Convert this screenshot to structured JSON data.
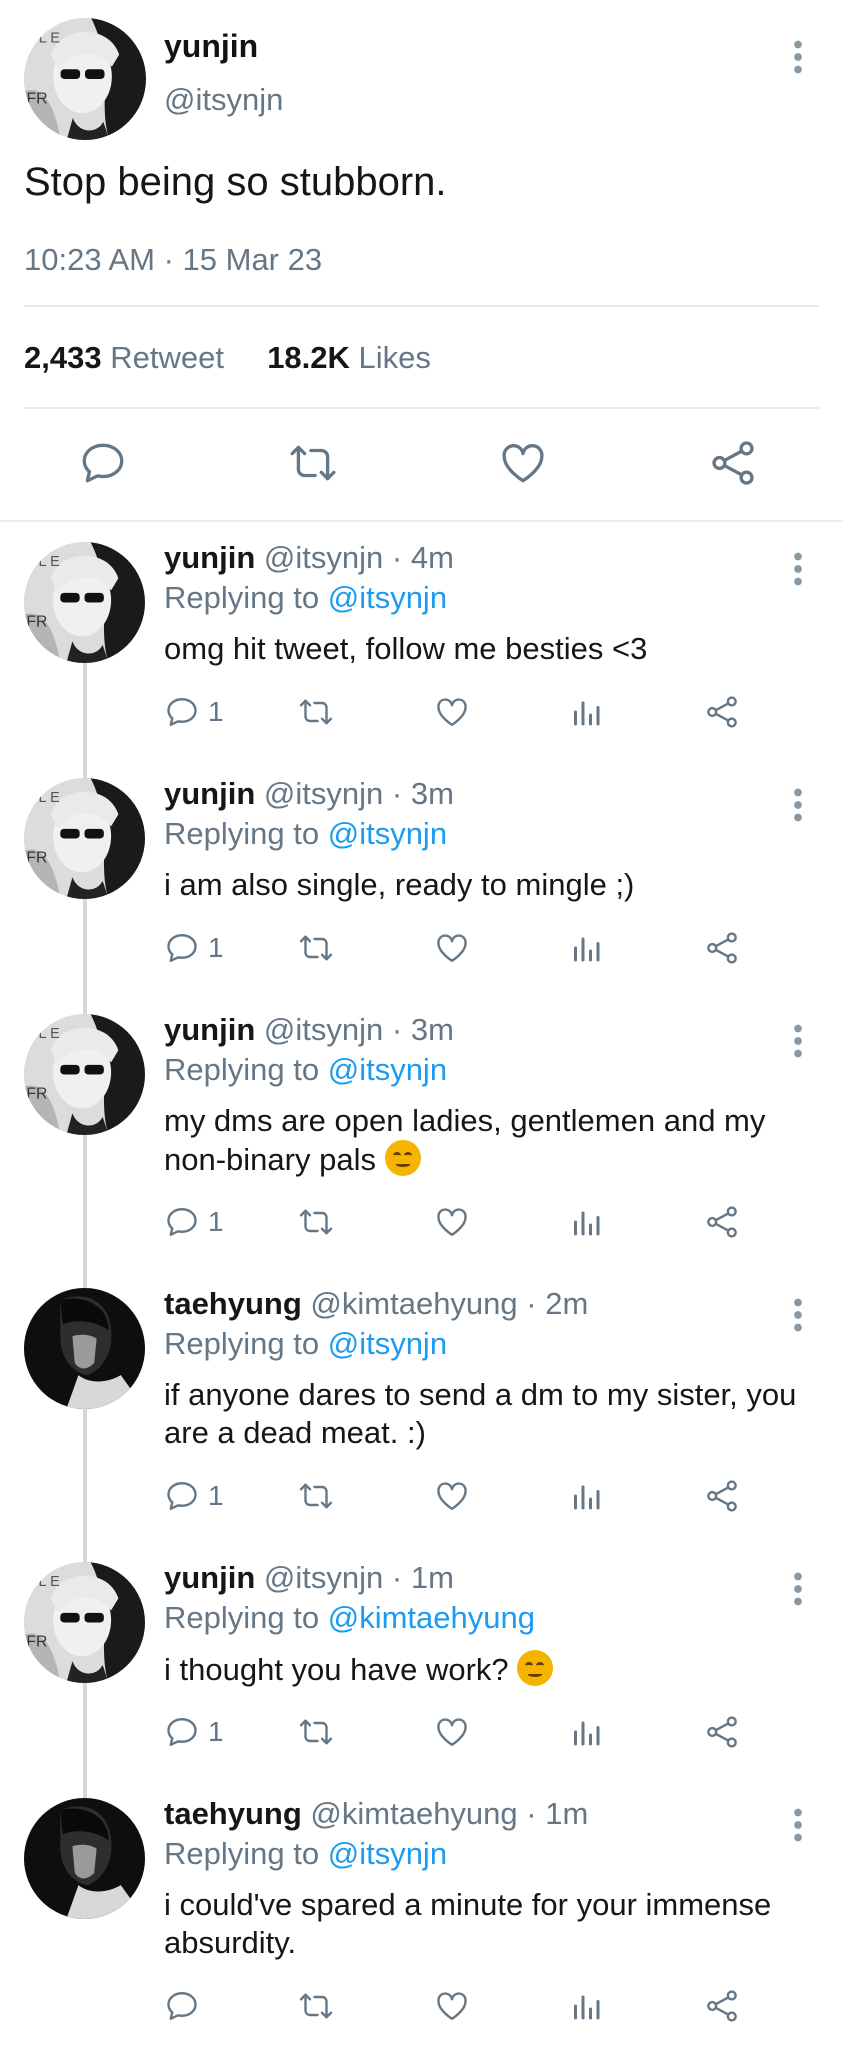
{
  "main_tweet": {
    "author_name": "yunjin",
    "author_handle": "@itsynjn",
    "text": "Stop being so stubborn.",
    "timestamp": "10:23 AM · 15 Mar 23",
    "retweet_count": "2,433",
    "retweet_label": "Retweet",
    "like_count": "18.2K",
    "like_label": "Likes",
    "actions": [
      "reply-icon",
      "retweet-icon",
      "like-icon",
      "share-icon"
    ]
  },
  "replies": [
    {
      "name": "yunjin",
      "handle": "@itsynjn",
      "time": "4m",
      "replying_prefix": "Replying to",
      "replying_to": "@itsynjn",
      "text": "omg hit tweet, follow me besties <3",
      "reply_count": "1",
      "avatar": "yunjin"
    },
    {
      "name": "yunjin",
      "handle": "@itsynjn",
      "time": "3m",
      "replying_prefix": "Replying to",
      "replying_to": "@itsynjn",
      "text": "i am also single, ready to mingle ;)",
      "reply_count": "1",
      "avatar": "yunjin"
    },
    {
      "name": "yunjin",
      "handle": "@itsynjn",
      "time": "3m",
      "replying_prefix": "Replying to",
      "replying_to": "@itsynjn",
      "text": "my dms are open ladies, gentlemen and my non-binary pals",
      "emoji": "smirk-emoji",
      "reply_count": "1",
      "avatar": "yunjin"
    },
    {
      "name": "taehyung",
      "handle": "@kimtaehyung",
      "time": "2m",
      "replying_prefix": "Replying to",
      "replying_to": "@itsynjn",
      "text": "if anyone dares to send a dm to my sister, you are a dead meat. :)",
      "reply_count": "1",
      "avatar": "taehyung"
    },
    {
      "name": "yunjin",
      "handle": "@itsynjn",
      "time": "1m",
      "replying_prefix": "Replying to",
      "replying_to": "@kimtaehyung",
      "text": "i thought you have work?",
      "emoji": "yawning-emoji",
      "reply_count": "1",
      "avatar": "yunjin"
    },
    {
      "name": "taehyung",
      "handle": "@kimtaehyung",
      "time": "1m",
      "replying_prefix": "Replying to",
      "replying_to": "@itsynjn",
      "text": "i could've spared a minute for your immense absurdity.",
      "reply_count": "",
      "avatar": "taehyung"
    }
  ],
  "colors": {
    "text": "#14171a",
    "secondary": "#657786",
    "link": "#1d9bf0",
    "divider": "#e6ecf0"
  }
}
